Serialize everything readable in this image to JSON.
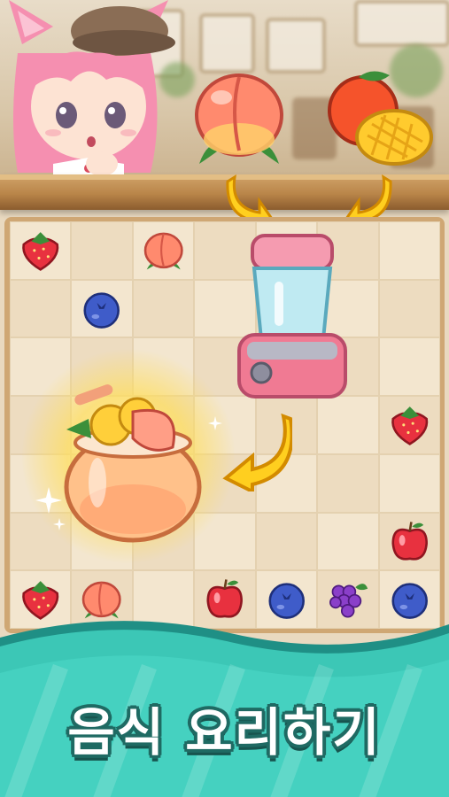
{
  "banner": {
    "title": "음식 요리하기"
  },
  "recipe": {
    "ingredients": [
      "peach-icon",
      "mango-orange-icon"
    ],
    "tool": "blender-icon",
    "result": "peach-juice-icon"
  },
  "board": {
    "rows": 7,
    "cols": 7,
    "items": [
      {
        "icon": "strawberry-icon",
        "row": 0,
        "col": 0
      },
      {
        "icon": "peach-icon",
        "row": 0,
        "col": 2
      },
      {
        "icon": "blueberry-icon",
        "row": 1,
        "col": 1
      },
      {
        "icon": "strawberry-icon",
        "row": 3,
        "col": 6
      },
      {
        "icon": "apple-icon",
        "row": 5,
        "col": 6
      },
      {
        "icon": "strawberry-icon",
        "row": 6,
        "col": 0
      },
      {
        "icon": "peach-icon",
        "row": 6,
        "col": 1
      },
      {
        "icon": "apple-icon",
        "row": 6,
        "col": 3
      },
      {
        "icon": "blueberry-icon",
        "row": 6,
        "col": 4
      },
      {
        "icon": "grape-icon",
        "row": 6,
        "col": 5
      },
      {
        "icon": "blueberry-icon",
        "row": 6,
        "col": 6
      }
    ]
  },
  "colors": {
    "wave_teal": "#3cc7b6",
    "title_outline": "#1f6a63",
    "arrow_yellow": "#ffcf1f",
    "board_frame": "#cfa774"
  }
}
